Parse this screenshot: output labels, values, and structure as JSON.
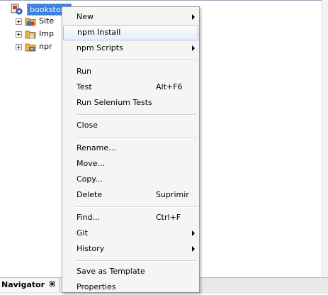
{
  "tree": {
    "root_label": "bookstore",
    "children": [
      {
        "label": "Site",
        "icon": "site-folder-icon"
      },
      {
        "label": "Imp",
        "icon": "important-files-folder-icon"
      },
      {
        "label": "npr",
        "icon": "npm-libraries-folder-icon"
      }
    ]
  },
  "navigator": {
    "tab_label": "Navigator",
    "close_glyph": "⌘"
  },
  "context_menu": {
    "new": "New",
    "npm_install": "npm Install",
    "npm_scripts": "npm Scripts",
    "run": "Run",
    "test": "Test",
    "test_shortcut": "Alt+F6",
    "run_selenium": "Run Selenium Tests",
    "close": "Close",
    "rename": "Rename...",
    "move": "Move...",
    "copy": "Copy...",
    "delete": "Delete",
    "delete_shortcut": "Suprimir",
    "find": "Find...",
    "find_shortcut": "Ctrl+F",
    "git": "Git",
    "history": "History",
    "save_as_template": "Save as Template",
    "properties": "Properties"
  },
  "colors": {
    "selection": "#3d80df",
    "menu_background": "#f5f5f5",
    "hover_border": "#a9c1e6"
  }
}
